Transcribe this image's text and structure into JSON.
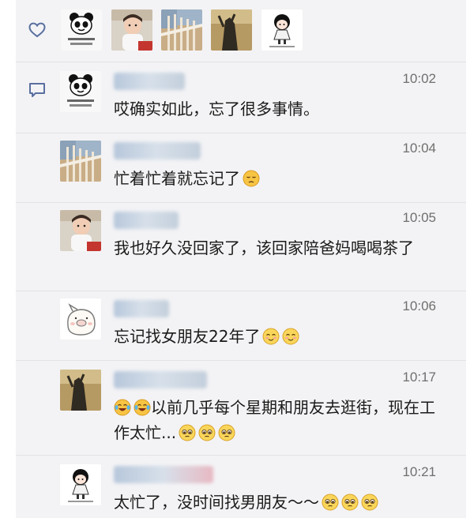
{
  "likes": {
    "icon": "heart-outline-icon",
    "avatars": [
      "panda-meme-avatar",
      "toddler-photo-avatar",
      "railing-photo-avatar",
      "shadow-photo-avatar",
      "cartoon-girl-avatar"
    ]
  },
  "comments_icon": "comment-bubble-icon",
  "comments": [
    {
      "avatar": "panda-meme-avatar",
      "time": "10:02",
      "text": "哎确实如此，忘了很多事情。",
      "emojis": []
    },
    {
      "avatar": "railing-photo-avatar",
      "time": "10:04",
      "text": "忙着忙着就忘记了",
      "emojis": [
        "pensive-emoji"
      ]
    },
    {
      "avatar": "toddler-photo-avatar",
      "time": "10:05",
      "text": "我也好久没回家了，该回家陪爸妈喝喝茶了",
      "emojis": []
    },
    {
      "avatar": "pig-doodle-avatar",
      "time": "10:06",
      "text": "忘记找女朋友22年了",
      "emojis": [
        "blushing-smile-emoji",
        "blushing-smile-emoji"
      ]
    },
    {
      "avatar": "shadow-photo-avatar",
      "time": "10:17",
      "text": "以前几乎每个星期和朋友去逛街，现在工作太忙...",
      "lead_emojis": [
        "crying-laughing-emoji",
        "crying-laughing-emoji"
      ],
      "emojis": [
        "pleading-emoji",
        "pleading-emoji",
        "pleading-emoji"
      ]
    },
    {
      "avatar": "cartoon-girl-avatar",
      "time": "10:21",
      "text": "太忙了，没时间找男朋友～～",
      "emojis": [
        "pleading-emoji",
        "pleading-emoji",
        "pleading-emoji"
      ]
    }
  ],
  "colors": {
    "panel_bg": "#f3f3f5",
    "icon_blue": "#5a6fa0",
    "time_gray": "#6f6f6f",
    "text": "#1a1a1a"
  }
}
